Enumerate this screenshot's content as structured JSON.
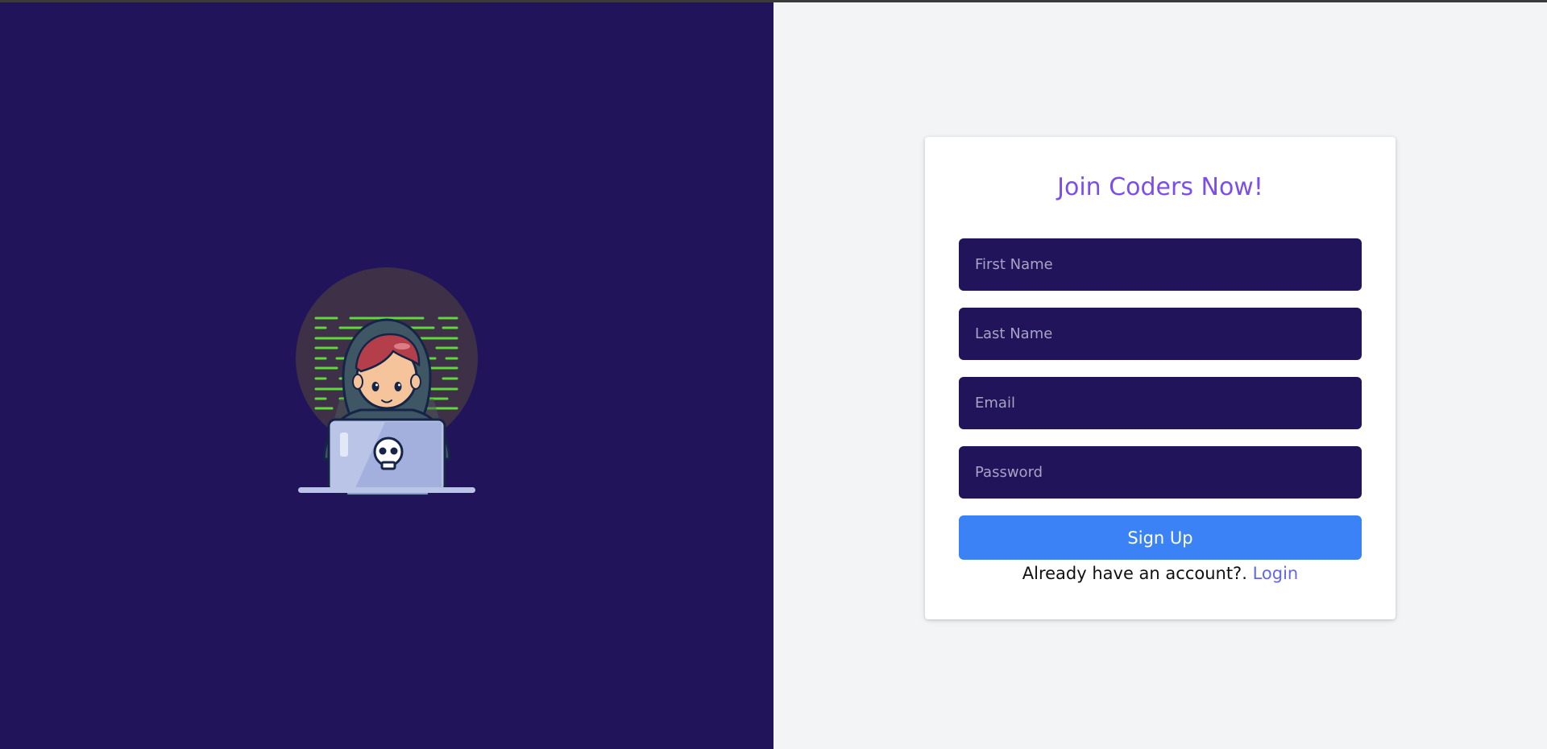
{
  "colors": {
    "left_panel_bg": "#21145a",
    "right_panel_bg": "#f3f4f6",
    "card_bg": "#ffffff",
    "title": "#7c4ded",
    "input_bg": "#21145a",
    "button": "#3b82f6",
    "link": "#6366f1"
  },
  "illustration": {
    "name": "hacker-with-laptop-illustration"
  },
  "signup": {
    "title": "Join Coders Now!",
    "fields": {
      "first_name": {
        "value": "",
        "placeholder": "First Name"
      },
      "last_name": {
        "value": "",
        "placeholder": "Last Name"
      },
      "email": {
        "value": "",
        "placeholder": "Email"
      },
      "password": {
        "value": "",
        "placeholder": "Password"
      }
    },
    "submit_label": "Sign Up",
    "footer_text": "Already have an account?.",
    "login_link": "Login"
  }
}
